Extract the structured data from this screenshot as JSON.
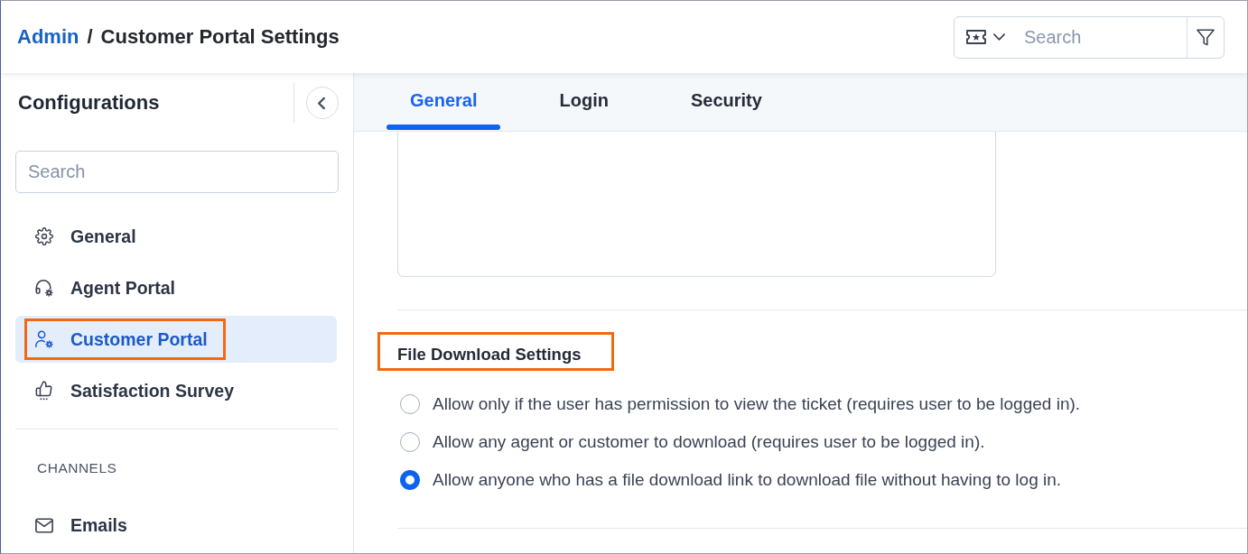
{
  "header": {
    "breadcrumb": {
      "parent": "Admin",
      "separator": "/",
      "current": "Customer Portal Settings"
    },
    "search": {
      "placeholder": "Search"
    }
  },
  "sidebar": {
    "title": "Configurations",
    "search": {
      "placeholder": "Search"
    },
    "items": [
      {
        "label": "General",
        "selected": false,
        "highlighted": false
      },
      {
        "label": "Agent Portal",
        "selected": false,
        "highlighted": false
      },
      {
        "label": "Customer Portal",
        "selected": true,
        "highlighted": true
      },
      {
        "label": "Satisfaction Survey",
        "selected": false,
        "highlighted": false
      }
    ],
    "groups": [
      {
        "heading": "CHANNELS",
        "items": [
          {
            "label": "Emails",
            "selected": false,
            "highlighted": false
          }
        ]
      }
    ]
  },
  "tabs": [
    {
      "label": "General",
      "selected": true
    },
    {
      "label": "Login",
      "selected": false
    },
    {
      "label": "Security",
      "selected": false
    }
  ],
  "content": {
    "sections": [
      {
        "title": "File Download Settings",
        "highlighted": true,
        "options": [
          {
            "label": "Allow only if the user has permission to view the ticket (requires user to be logged in).",
            "selected": false
          },
          {
            "label": "Allow any agent or customer to download (requires user to be logged in).",
            "selected": false
          },
          {
            "label": "Allow anyone who has a file download link to download file without having to log in.",
            "selected": true
          }
        ]
      }
    ]
  }
}
